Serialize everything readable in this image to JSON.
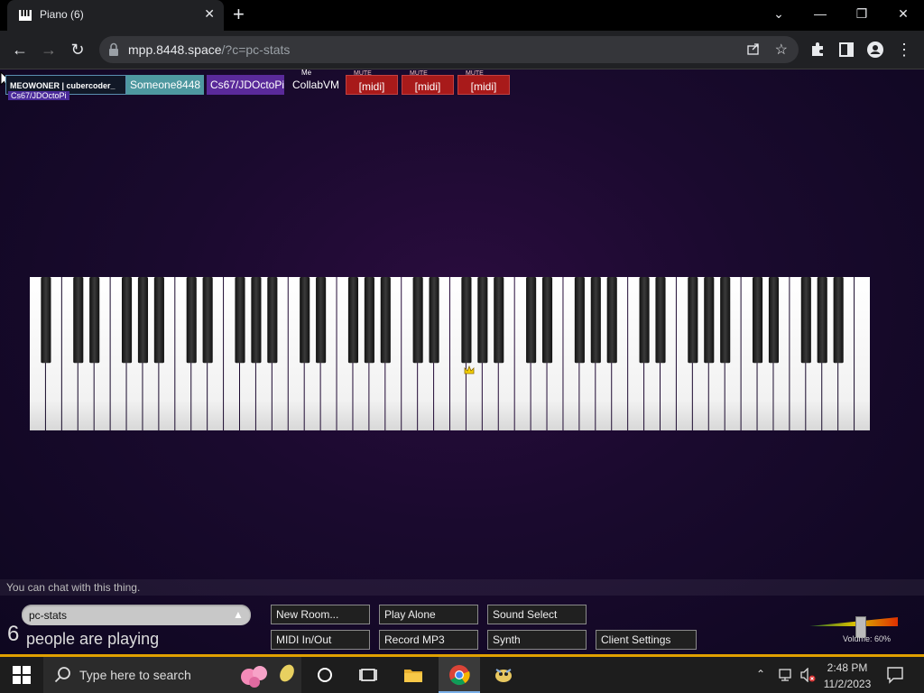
{
  "browser": {
    "tab_title": "Piano (6)",
    "url_host": "mpp.8448.space",
    "url_path": "/?c=pc-stats"
  },
  "users": {
    "u1": "MEOWONER | cubercoder_",
    "u2": "Someone8448",
    "u3": "Cs67/JDOctoPi",
    "u4_top": "Me",
    "u4": "CollabVM",
    "sub": "Cs67/JDOctoPi",
    "mute_small": "MUTE",
    "midi": "[midi]"
  },
  "chat": {
    "hint": "You can chat with this thing."
  },
  "room": {
    "name": "pc-stats",
    "arrow": "▲",
    "count": "6",
    "playing": "people are playing"
  },
  "buttons": {
    "new_room": "New Room...",
    "play_alone": "Play Alone",
    "sound_select": "Sound Select",
    "midi_inout": "MIDI In/Out",
    "record_mp3": "Record MP3",
    "synth": "Synth",
    "client_settings": "Client Settings"
  },
  "volume": {
    "label": "Volume: 60%",
    "level": 0.6
  },
  "taskbar": {
    "search_placeholder": "Type here to search",
    "time": "2:48 PM",
    "date": "11/2/2023"
  }
}
